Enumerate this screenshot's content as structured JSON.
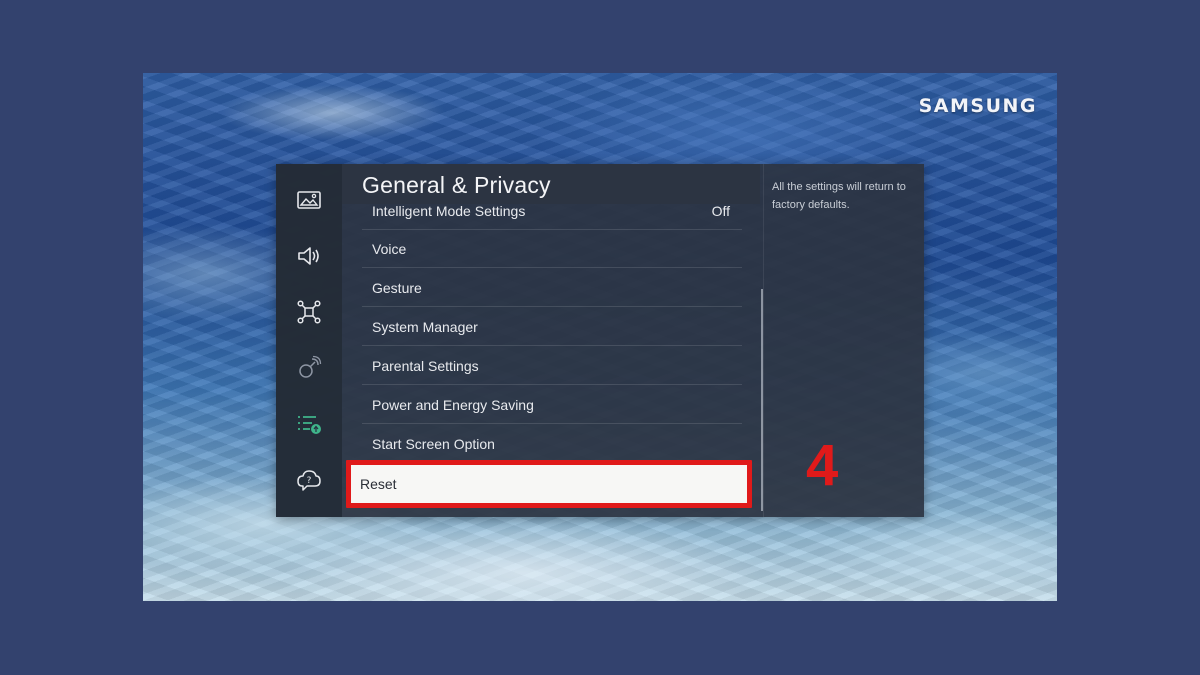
{
  "brand": "SAMSUNG",
  "menu": {
    "title": "General & Privacy",
    "items": [
      {
        "label": "Intelligent Mode Settings",
        "value": "Off"
      },
      {
        "label": "Voice"
      },
      {
        "label": "Gesture"
      },
      {
        "label": "System Manager"
      },
      {
        "label": "Parental Settings"
      },
      {
        "label": "Power and Energy Saving"
      },
      {
        "label": "Start Screen Option"
      },
      {
        "label": "Reset"
      }
    ],
    "selected_index": 7,
    "description": "All the settings will return to factory defaults."
  },
  "sidebar": {
    "icons": [
      "picture-icon",
      "sound-icon",
      "connection-icon",
      "broadcasting-icon",
      "general-privacy-icon",
      "support-icon"
    ],
    "active_color": "#3fb58a"
  },
  "annotation": {
    "step": "4",
    "color": "#e01a1a"
  }
}
